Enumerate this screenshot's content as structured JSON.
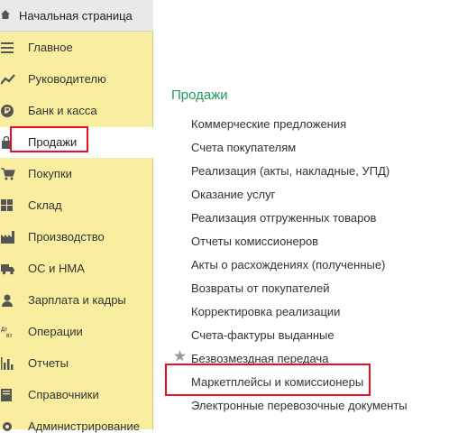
{
  "home": {
    "label": "Начальная страница"
  },
  "sidebar": {
    "items": [
      {
        "label": "Главное",
        "icon": "menu-icon"
      },
      {
        "label": "Руководителю",
        "icon": "trend-icon"
      },
      {
        "label": "Банк и касса",
        "icon": "ruble-icon"
      },
      {
        "label": "Продажи",
        "icon": "bag-icon",
        "active": true
      },
      {
        "label": "Покупки",
        "icon": "cart-icon"
      },
      {
        "label": "Склад",
        "icon": "warehouse-icon"
      },
      {
        "label": "Производство",
        "icon": "factory-icon"
      },
      {
        "label": "ОС и НМА",
        "icon": "truck-icon"
      },
      {
        "label": "Зарплата и кадры",
        "icon": "person-icon"
      },
      {
        "label": "Операции",
        "icon": "dt-kt-icon"
      },
      {
        "label": "Отчеты",
        "icon": "bar-chart-icon"
      },
      {
        "label": "Справочники",
        "icon": "book-icon"
      },
      {
        "label": "Администрирование",
        "icon": "gear-icon"
      }
    ]
  },
  "content": {
    "section_title": "Продажи",
    "links": [
      "Коммерческие предложения",
      "Счета покупателям",
      "Реализация (акты, накладные, УПД)",
      "Оказание услуг",
      "Реализация отгруженных товаров",
      "Отчеты комиссионеров",
      "Акты о расхождениях (полученные)",
      "Возвраты от покупателей",
      "Корректировка реализации",
      "Счета-фактуры выданные",
      "Безвозмездная передача",
      "Маркетплейсы и комиссионеры",
      "Электронные перевозочные документы"
    ]
  },
  "colors": {
    "sidebar_bg": "#f9eea0",
    "section_title": "#1f9a56",
    "highlight_box": "#e8101e"
  }
}
